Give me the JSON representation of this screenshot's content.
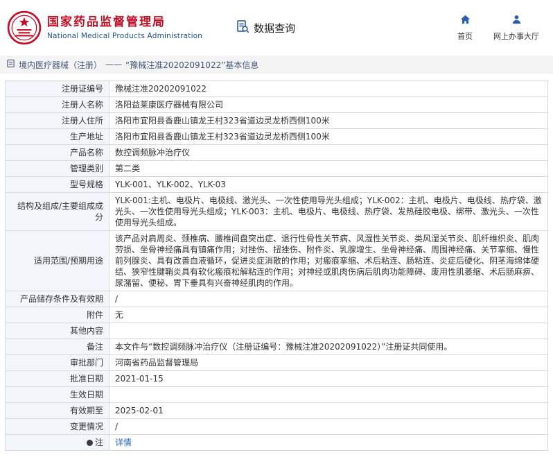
{
  "header": {
    "org_name_cn": "国家药品监督管理局",
    "org_name_en": "National Medical Products Administration",
    "data_query_label": "数据查询",
    "nav_home_label": "首页",
    "nav_service_hall_label": "网上办事大厅"
  },
  "icons": {
    "emblem": "national-emblem",
    "data_query": "document-magnifier",
    "home": "house",
    "service_hall": "person",
    "breadcrumb": "form-page",
    "note": "dark-dot"
  },
  "colors": {
    "brand_red": "#c30d23",
    "brand_blue": "#1d5199",
    "nav_icon_blue": "#2b5fae",
    "link_blue": "#2567c7",
    "label_cell_bg": "#f2f6fb",
    "breadcrumb_bg": "#f4f4f4"
  },
  "breadcrumb": {
    "section": "境内医疗器械（注册）",
    "separator": "——",
    "current": "“豫械注准20202091022”基本信息"
  },
  "table": {
    "rows": [
      {
        "label": "注册证编号",
        "value": "豫械注准20202091022"
      },
      {
        "label": "注册人名称",
        "value": "洛阳益莱康医疗器械有限公司"
      },
      {
        "label": "注册人住所",
        "value": "洛阳市宜阳县香鹿山镇龙王村323省道边灵龙桥西侧100米"
      },
      {
        "label": "生产地址",
        "value": "洛阳市宜阳县香鹿山镇龙王村323省道边灵龙桥西侧100米"
      },
      {
        "label": "产品名称",
        "value": "数控调频脉冲治疗仪"
      },
      {
        "label": "管理类别",
        "value": "第二类"
      },
      {
        "label": "型号规格",
        "value": "YLK-001、YLK-002、YLK-03"
      },
      {
        "label": "结构及组成/主要组成成分",
        "value": "YLK-001:主机、电极片、电极线、激光头、一次性使用导光头组成；YLK-002：主机、电极片、电极线、热疗袋、激光头、一次性使用导光头组成；YLK-003：主机、电极片、电极线、热疗袋、发热硅胶电极、绑带、激光头、一次性使用导光头组成。"
      },
      {
        "label": "适用范围/预期用途",
        "value": "该产品对肩周炎、颈椎病、腰椎间盘突出症、退行性骨性关节病、风湿性关节炎、类风湿关节炎、肌纤维织炎、肌肉劳损、坐骨神经痛具有镇痛作用；对挫伤、扭挫伤、附件炎、乳腺增生、坐骨神经痛、周围神经痛、关节挛缩、慢性前列腺炎、具有改善血液循环，促进炎症消散的作用；对瘢痕挛缩、术后粘连、肠粘连、炎症后硬化、阴茎海绵体硬结、狭窄性腱鞘炎具有软化瘢痕松解粘连的作用；对神经或肌肉伤病后肌肉功能障碍、废用性肌萎缩、术后肠麻痹、尿潴留、便秘、胃下垂具有兴奋神经肌肉的作用。"
      },
      {
        "label": "产品储存条件及有效期",
        "value": "/"
      },
      {
        "label": "附件",
        "value": "无"
      },
      {
        "label": "其他内容",
        "value": ""
      },
      {
        "label": "备注",
        "value": "本文件与“数控调频脉冲治疗仪（注册证编号：豫械注准20202091022）”注册证共同使用。"
      },
      {
        "label": "审批部门",
        "value": "河南省药品监督管理局"
      },
      {
        "label": "批准日期",
        "value": "2021-01-15"
      },
      {
        "label": "生效日期",
        "value": ""
      },
      {
        "label": "有效期至",
        "value": "2025-02-01"
      },
      {
        "label": "变更情况",
        "value": "/"
      },
      {
        "label": "注",
        "value": "详情"
      }
    ]
  }
}
